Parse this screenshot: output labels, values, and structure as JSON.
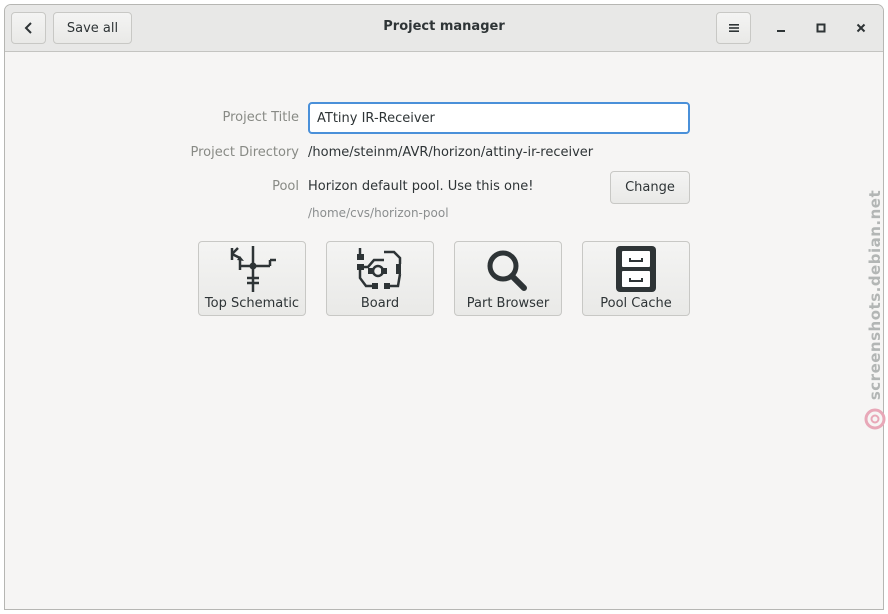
{
  "header": {
    "title": "Project manager",
    "save_all_label": "Save all",
    "back_icon": "chevron-left-icon",
    "menu_icon": "hamburger-menu-icon"
  },
  "form": {
    "project_title_label": "Project Title",
    "project_title_value": "ATtiny IR-Receiver",
    "project_directory_label": "Project Directory",
    "project_directory_value": "/home/steinm/AVR/horizon/attiny-ir-receiver",
    "pool_label": "Pool",
    "pool_name": "Horizon default pool. Use this one!",
    "pool_path": "/home/cvs/horizon-pool",
    "change_label": "Change"
  },
  "tiles": [
    {
      "label": "Top Schematic",
      "icon": "schematic-icon"
    },
    {
      "label": "Board",
      "icon": "board-icon"
    },
    {
      "label": "Part Browser",
      "icon": "magnifier-icon"
    },
    {
      "label": "Pool Cache",
      "icon": "file-cabinet-icon"
    }
  ],
  "watermark": {
    "text": "screenshots.debian.net"
  },
  "colors": {
    "accent": "#4a90d9",
    "background": "#f6f5f4",
    "headerbar": "#e8e8e7"
  }
}
